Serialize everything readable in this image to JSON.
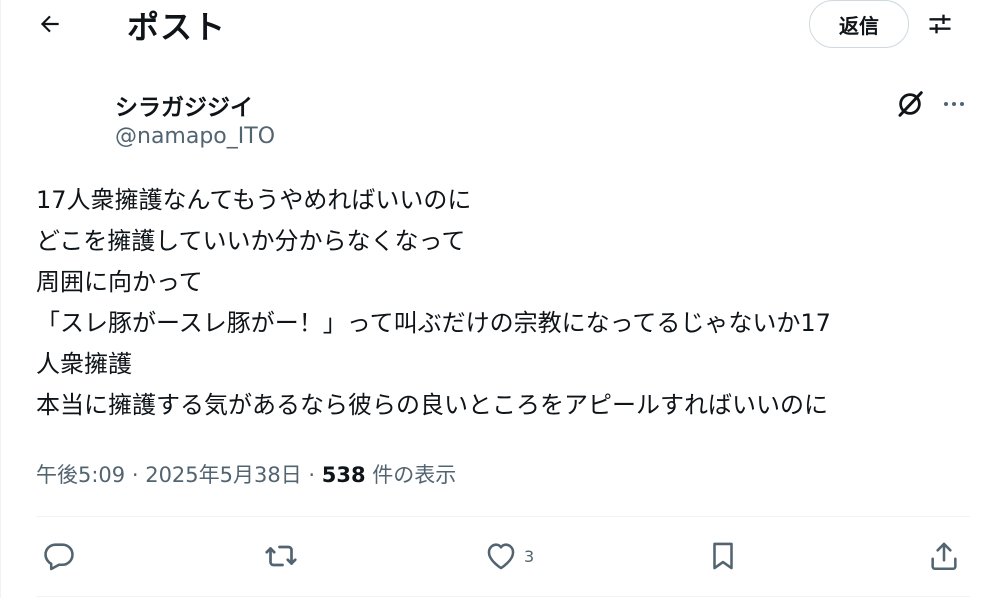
{
  "header": {
    "title": "ポスト",
    "reply_label": "返信",
    "back_icon": "arrow-left-icon",
    "settings_icon": "sliders-icon"
  },
  "author": {
    "name": "シラガジジイ",
    "handle": "@namapo_ITO"
  },
  "post": {
    "lines": [
      "17人衆擁護なんてもうやめればいいのに",
      "どこを擁護していいか分からなくなって",
      "周囲に向かって",
      "「スレ豚がースレ豚がー！」って叫ぶだけの宗教になってるじゃないか17",
      "人衆擁護",
      "本当に擁護する気があるなら彼らの良いところをアピールすればいいのに"
    ]
  },
  "meta": {
    "time": "午後5:09",
    "separator": " · ",
    "date": "2025年5月38日",
    "views_count": "538",
    "views_label": " 件の表示"
  },
  "actions": {
    "like_count": "3"
  },
  "colors": {
    "text": "#0f1419",
    "secondary": "#536471",
    "border": "#cfd9de",
    "divider": "#eff3f4"
  }
}
